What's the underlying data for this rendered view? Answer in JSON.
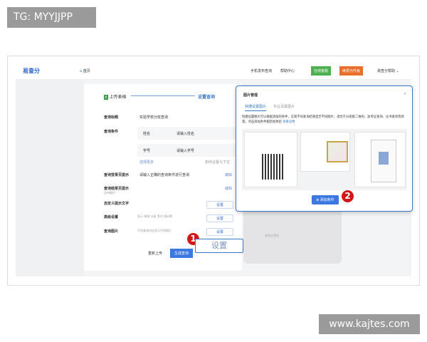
{
  "tag": "TG: MYYJJPP",
  "watermark": "www.kajtes.com",
  "header": {
    "logo": "易查分",
    "home": "首页",
    "mobile": "手机发布查询",
    "help": "帮助中心",
    "online": "在线客服",
    "renew": "续费为升级",
    "user": "易查分帮助"
  },
  "steps": {
    "step1": "上传表格",
    "step2": "设置查询"
  },
  "form": {
    "title_label": "查询标题",
    "title_value": "实验学校分班查询",
    "cond_label": "查询条件",
    "conditions": [
      {
        "name": "姓名",
        "placeholder": "请输入姓名"
      },
      {
        "name": "学号",
        "placeholder": "请输入学号"
      }
    ],
    "select_more": "选择更多",
    "dropdown_hint": "如何设置为下拉",
    "login_tip_label": "查询登录页提示",
    "login_tip_value": "请输入正确的查询条件进行查询",
    "result_tip_label": "查询结果页提示",
    "result_tip_sub": "支持图片",
    "edit": "编辑",
    "custom_label": "自定义提示文字",
    "advanced_label": "高级设置",
    "advanced_hint": "显示 修改 分组 签名 密码等",
    "image_label": "查询图片",
    "image_hint": "不同查询对应显示不同图片",
    "set": "设置",
    "reupload": "重新上传",
    "generate": "生成查询"
  },
  "callout": {
    "number1": "1",
    "set_big": "设置",
    "number2": "2"
  },
  "modal": {
    "title": "图片管理",
    "close": "×",
    "tabs": [
      "快捷设置图片",
      "专业设置图片"
    ],
    "desc": "快捷设置图片可以根据添加的条件，实现不同查询结果显示不同图片，适合于分班群二维码、准考证查询、证书查询等场景。点击添加条件能轻松体验",
    "desc_link": "查看详情",
    "add": "添加条件"
  },
  "preview": {
    "label": "查询分预览"
  },
  "colors": {
    "accent": "#3b78c4",
    "online": "#4caf50",
    "renew": "#e8702a",
    "badge": "#d01818"
  }
}
